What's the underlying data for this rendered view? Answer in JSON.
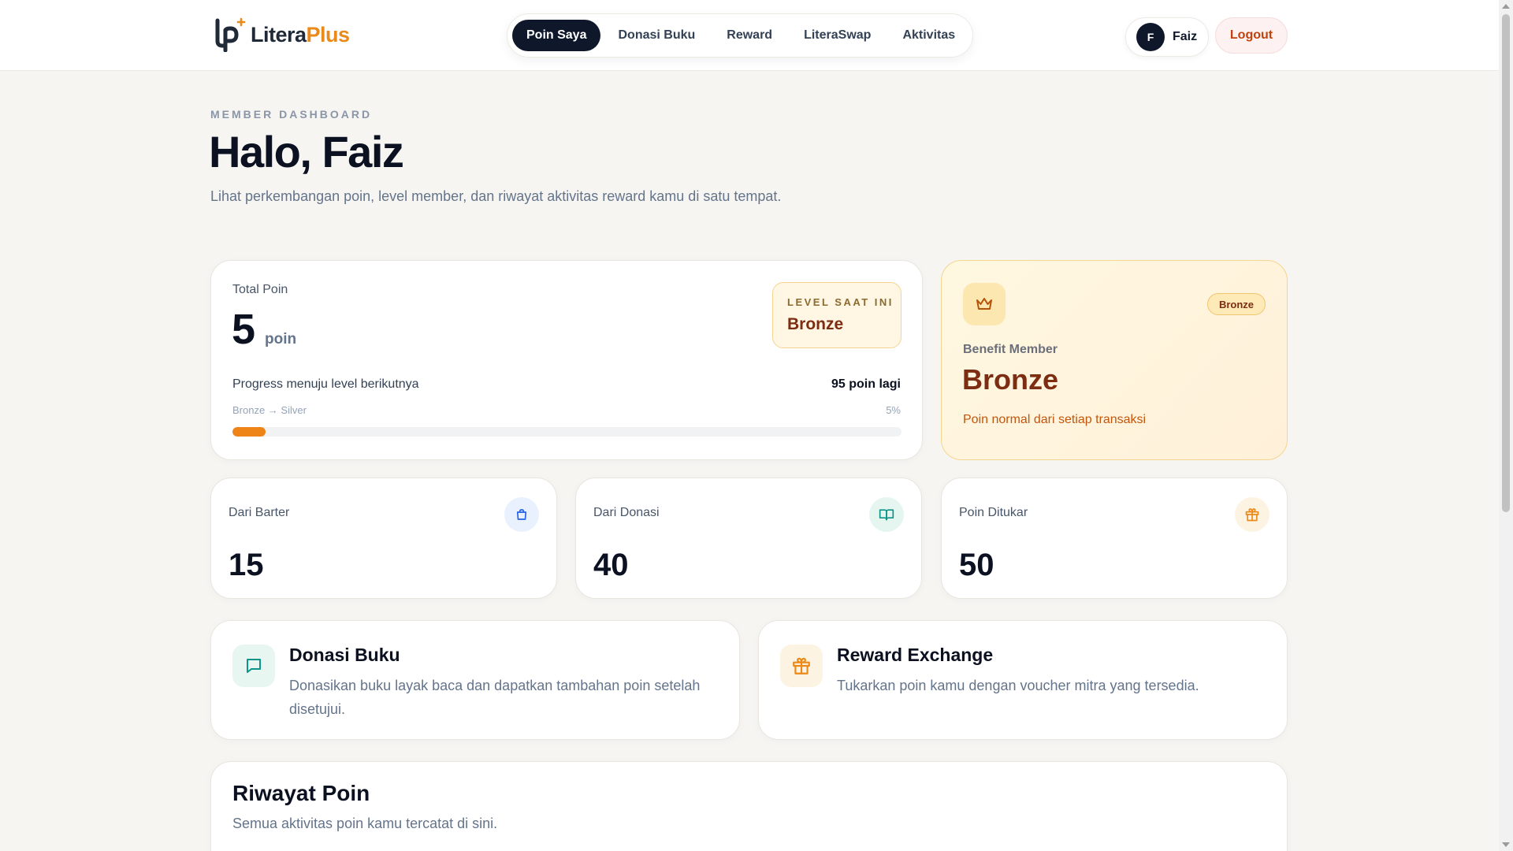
{
  "brand": {
    "name_part1": "Litera",
    "name_part2": "Plus",
    "accent": "#e98a19",
    "mark": "lp-logo"
  },
  "nav": {
    "items": [
      {
        "label": "Poin Saya",
        "active": true
      },
      {
        "label": "Donasi Buku",
        "active": false
      },
      {
        "label": "Reward",
        "active": false
      },
      {
        "label": "LiteraSwap",
        "active": false
      },
      {
        "label": "Aktivitas",
        "active": false
      }
    ]
  },
  "user": {
    "initial": "F",
    "name": "Faiz",
    "logout_label": "Logout"
  },
  "hero": {
    "eyebrow": "MEMBER DASHBOARD",
    "title": "Halo, Faiz",
    "description": "Lihat perkembangan poin, level member, dan riwayat aktivitas reward kamu di satu tempat."
  },
  "total": {
    "label": "Total Poin",
    "value": "5",
    "unit": "poin",
    "level_eyebrow": "LEVEL SAAT INI",
    "level": "Bronze",
    "progress_label": "Progress menuju level berikutnya",
    "progress_remaining": "95 poin lagi",
    "progress_route": "Bronze → Silver",
    "progress_percent_text": "5%",
    "progress_fraction": 0.05,
    "progress_color": "#ee8417"
  },
  "benefit": {
    "icon": "crown-icon",
    "badge": "Bronze",
    "label": "Benefit Member",
    "level": "Bronze",
    "description": "Poin normal dari setiap transaksi"
  },
  "stats": [
    {
      "label": "Dari Barter",
      "value": "15",
      "icon": "bag-icon",
      "icon_color": "#2563eb",
      "icon_bg": "#e8f1fd"
    },
    {
      "label": "Dari Donasi",
      "value": "40",
      "icon": "book-open-icon",
      "icon_color": "#0d9488",
      "icon_bg": "#e5f6f1"
    },
    {
      "label": "Poin Ditukar",
      "value": "50",
      "icon": "gift-icon",
      "icon_color": "#e98a19",
      "icon_bg": "#fdf3e2"
    }
  ],
  "actions": [
    {
      "title": "Donasi Buku",
      "description": "Donasikan buku layak baca dan dapatkan tambahan poin setelah disetujui.",
      "icon": "chat-square-icon"
    },
    {
      "title": "Reward Exchange",
      "description": "Tukarkan poin kamu dengan voucher mitra yang tersedia.",
      "icon": "gift-icon"
    }
  ],
  "history": {
    "title": "Riwayat Poin",
    "description": "Semua aktivitas poin kamu tercatat di sini."
  }
}
